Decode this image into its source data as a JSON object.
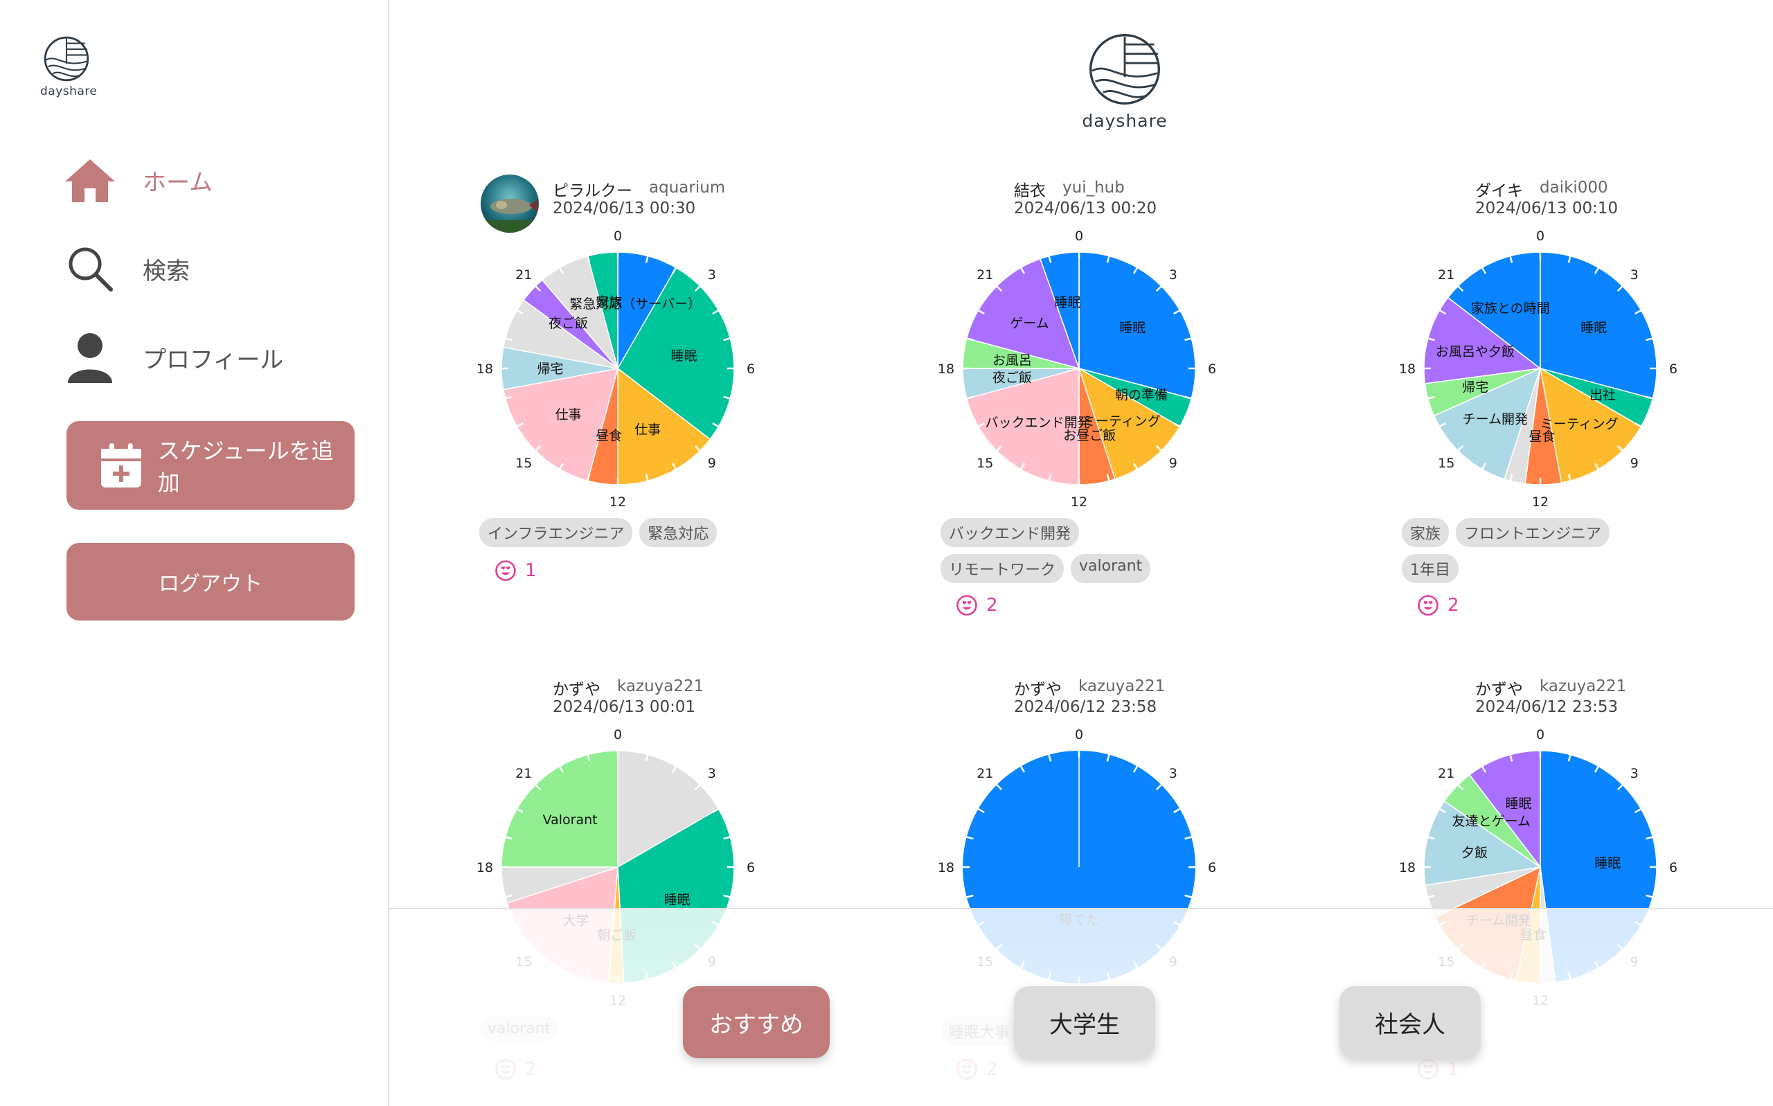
{
  "brand": {
    "name": "dayshare"
  },
  "nav": {
    "home": "ホーム",
    "search": "検索",
    "profile": "プロフィール",
    "add_schedule": "スケジュールを追加",
    "logout": "ログアウト"
  },
  "tabs": {
    "recommended": "おすすめ",
    "university": "大学生",
    "working": "社会人"
  },
  "colors": {
    "accent": "#c17b7b",
    "like": "#e0409a",
    "blue": "#0a84ff",
    "teal": "#00c49a",
    "yellow": "#fdba2c",
    "orange": "#ff8042",
    "pink": "#ffc0cb",
    "lightblue": "#add8e6",
    "lightgray": "#e0e0e0",
    "purple": "#a970ff",
    "lightgreen": "#90ee90"
  },
  "clock_labels": [
    "0",
    "3",
    "6",
    "9",
    "12",
    "15",
    "18",
    "21"
  ],
  "posts": [
    {
      "user_name": "ピラルクー",
      "user_id": "aquarium",
      "date": "2024/06/13 00:30",
      "has_avatar": true,
      "tags": [
        "インフラエンジニア",
        "緊急対応"
      ],
      "likes": "1",
      "segments": [
        {
          "start": 0,
          "end": 2,
          "color": "blue",
          "label": "緊急対応（サーバー）"
        },
        {
          "start": 2,
          "end": 8.5,
          "color": "teal",
          "label": "睡眠"
        },
        {
          "start": 8.5,
          "end": 12,
          "color": "yellow",
          "label": "仕事"
        },
        {
          "start": 12,
          "end": 13,
          "color": "orange",
          "label": "昼食"
        },
        {
          "start": 13,
          "end": 17.3,
          "color": "pink",
          "label": "仕事"
        },
        {
          "start": 17.3,
          "end": 18.7,
          "color": "lightblue",
          "label": "帰宅"
        },
        {
          "start": 18.7,
          "end": 20.4,
          "color": "lightgray",
          "label": ""
        },
        {
          "start": 20.4,
          "end": 21.3,
          "color": "purple",
          "label": "夜ご飯"
        },
        {
          "start": 21.3,
          "end": 23,
          "color": "lightgray",
          "label": ""
        },
        {
          "start": 23,
          "end": 24,
          "color": "teal",
          "label": "家族"
        }
      ]
    },
    {
      "user_name": "結衣",
      "user_id": "yui_hub",
      "date": "2024/06/13 00:20",
      "has_avatar": false,
      "tags": [
        "バックエンド開発",
        "リモートワーク",
        "valorant"
      ],
      "likes": "2",
      "segments": [
        {
          "start": 0,
          "end": 7,
          "color": "blue",
          "label": "睡眠"
        },
        {
          "start": 7,
          "end": 8,
          "color": "teal",
          "label": "朝の準備"
        },
        {
          "start": 8,
          "end": 10.8,
          "color": "yellow",
          "label": "ミーティング"
        },
        {
          "start": 10.8,
          "end": 12,
          "color": "orange",
          "label": "お昼ご飯"
        },
        {
          "start": 12,
          "end": 17,
          "color": "pink",
          "label": "バックエンド開発"
        },
        {
          "start": 17,
          "end": 18,
          "color": "lightblue",
          "label": "夜ご飯"
        },
        {
          "start": 18,
          "end": 19,
          "color": "lightgreen",
          "label": "お風呂"
        },
        {
          "start": 19,
          "end": 22.7,
          "color": "purple",
          "label": "ゲーム"
        },
        {
          "start": 22.7,
          "end": 24,
          "color": "blue",
          "label": "睡眠"
        }
      ]
    },
    {
      "user_name": "ダイキ",
      "user_id": "daiki000",
      "date": "2024/06/13 00:10",
      "has_avatar": false,
      "tags": [
        "家族",
        "フロントエンジニア",
        "1年目"
      ],
      "likes": "2",
      "segments": [
        {
          "start": 0,
          "end": 7,
          "color": "blue",
          "label": "睡眠"
        },
        {
          "start": 7,
          "end": 8,
          "color": "teal",
          "label": "出社"
        },
        {
          "start": 8,
          "end": 11.3,
          "color": "yellow",
          "label": "ミーティング"
        },
        {
          "start": 11.3,
          "end": 12.5,
          "color": "orange",
          "label": "昼食"
        },
        {
          "start": 12.5,
          "end": 13.2,
          "color": "lightgray",
          "label": ""
        },
        {
          "start": 13.2,
          "end": 16.4,
          "color": "lightblue",
          "label": "チーム開発"
        },
        {
          "start": 16.4,
          "end": 17.5,
          "color": "lightgreen",
          "label": "帰宅"
        },
        {
          "start": 17.5,
          "end": 20.5,
          "color": "purple",
          "label": "お風呂や夕飯"
        },
        {
          "start": 20.5,
          "end": 24,
          "color": "blue",
          "label": "家族との時間"
        }
      ]
    },
    {
      "user_name": "かずや",
      "user_id": "kazuya221",
      "date": "2024/06/13 00:01",
      "has_avatar": false,
      "tags": [
        "valorant"
      ],
      "likes": "2",
      "segments": [
        {
          "start": 0,
          "end": 4,
          "color": "lightgray",
          "label": ""
        },
        {
          "start": 4,
          "end": 11.8,
          "color": "teal",
          "label": "睡眠"
        },
        {
          "start": 11.8,
          "end": 12.3,
          "color": "yellow",
          "label": "朝ご飯"
        },
        {
          "start": 12.3,
          "end": 16.8,
          "color": "pink",
          "label": "大学"
        },
        {
          "start": 16.8,
          "end": 18,
          "color": "lightgray",
          "label": ""
        },
        {
          "start": 18,
          "end": 24,
          "color": "lightgreen",
          "label": "Valorant"
        }
      ]
    },
    {
      "user_name": "かずや",
      "user_id": "kazuya221",
      "date": "2024/06/12 23:58",
      "has_avatar": false,
      "tags": [
        "睡眠大事"
      ],
      "likes": "2",
      "segments": [
        {
          "start": 0,
          "end": 24,
          "color": "blue",
          "label": "寝てた"
        }
      ]
    },
    {
      "user_name": "かずや",
      "user_id": "kazuya221",
      "date": "2024/06/12 23:53",
      "has_avatar": false,
      "tags": [],
      "likes": "1",
      "segments": [
        {
          "start": 0,
          "end": 11.5,
          "color": "blue",
          "label": "睡眠"
        },
        {
          "start": 11.5,
          "end": 12,
          "color": "lightgray",
          "label": ""
        },
        {
          "start": 12,
          "end": 12.8,
          "color": "yellow",
          "label": "昼食"
        },
        {
          "start": 12.8,
          "end": 16.3,
          "color": "orange",
          "label": "チーム開発"
        },
        {
          "start": 16.3,
          "end": 17.4,
          "color": "lightgray",
          "label": ""
        },
        {
          "start": 17.4,
          "end": 20.3,
          "color": "lightblue",
          "label": "夕飯"
        },
        {
          "start": 20.3,
          "end": 21.5,
          "color": "lightgreen",
          "label": "友達とゲーム"
        },
        {
          "start": 21.5,
          "end": 24,
          "color": "purple",
          "label": "睡眠"
        }
      ]
    }
  ]
}
